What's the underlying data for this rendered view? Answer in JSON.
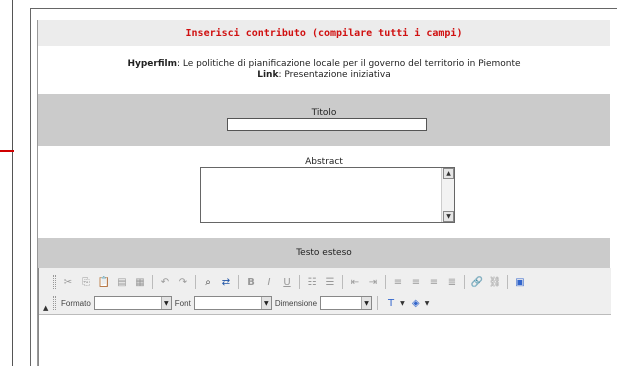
{
  "form": {
    "heading": "Inserisci contributo (compilare tutti i campi)",
    "hyperfilm_label": "Hyperfilm",
    "hyperfilm_value": ": Le politiche di pianificazione locale per il governo del territorio in Piemonte",
    "link_label": "Link",
    "link_value": ": Presentazione iniziativa",
    "titolo_label": "Titolo",
    "titolo_value": "",
    "abstract_label": "Abstract",
    "abstract_value": "",
    "testo_label": "Testo esteso"
  },
  "toolbar": {
    "row1": [
      "cut-icon",
      "copy-icon",
      "paste-icon",
      "paste-text-icon",
      "paste-word-icon",
      "undo-icon",
      "redo-icon",
      "find-icon",
      "replace-icon",
      "bold-icon",
      "italic-icon",
      "underline-icon",
      "ordered-list-icon",
      "unordered-list-icon",
      "outdent-icon",
      "indent-icon",
      "align-left-icon",
      "align-center-icon",
      "align-right-icon",
      "justify-icon",
      "link-icon",
      "unlink-icon",
      "image-icon"
    ],
    "formato_label": "Formato",
    "formato_value": "",
    "font_label": "Font",
    "font_value": "",
    "dimensione_label": "Dimensione",
    "dimensione_value": ""
  },
  "colors": {
    "heading_red": "#d01010",
    "band_gray": "#cbcbcb",
    "header_gray": "#ececec",
    "accent_tick": "#d00000"
  }
}
